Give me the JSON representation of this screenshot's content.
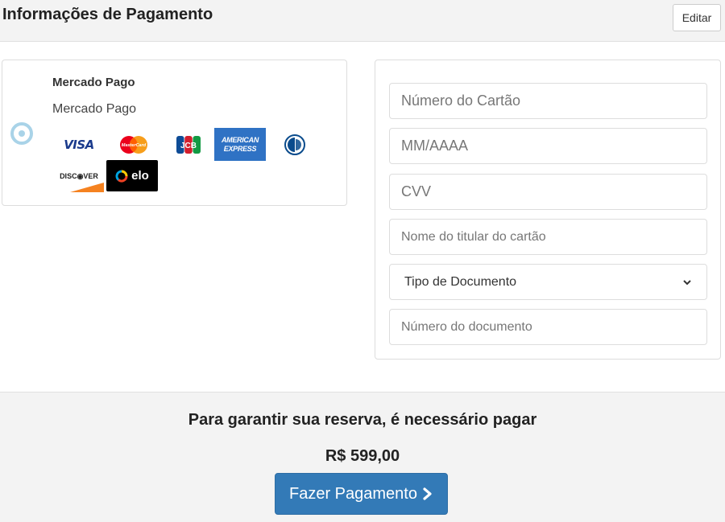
{
  "header": {
    "title": "Informações de Pagamento",
    "edit_label": "Editar"
  },
  "payment_method": {
    "name": "Mercado Pago",
    "subtitle": "Mercado Pago",
    "selected": true,
    "brands": {
      "visa": "VISA",
      "mastercard": "MasterCard",
      "jcb": "JCB",
      "amex_line1": "AMERICAN",
      "amex_line2": "EXPRESS",
      "diners": "diners-club-icon",
      "discover": "DISC◉VER",
      "elo": "elo"
    }
  },
  "form": {
    "card_number_placeholder": "Número do Cartão",
    "expiry_placeholder": "MM/AAAA",
    "cvv_placeholder": "CVV",
    "holder_placeholder": "Nome do titular do cartão",
    "doc_type_selected": "Tipo de Documento",
    "doc_number_placeholder": "Número do documento"
  },
  "footer": {
    "notice": "Para garantir sua reserva, é necessário pagar",
    "amount": "R$ 599,00",
    "pay_label": "Fazer Pagamento"
  },
  "colors": {
    "primary_button": "#337ab7",
    "radio_accent": "#a9d3e8",
    "amex_blue": "#2f72c4"
  }
}
